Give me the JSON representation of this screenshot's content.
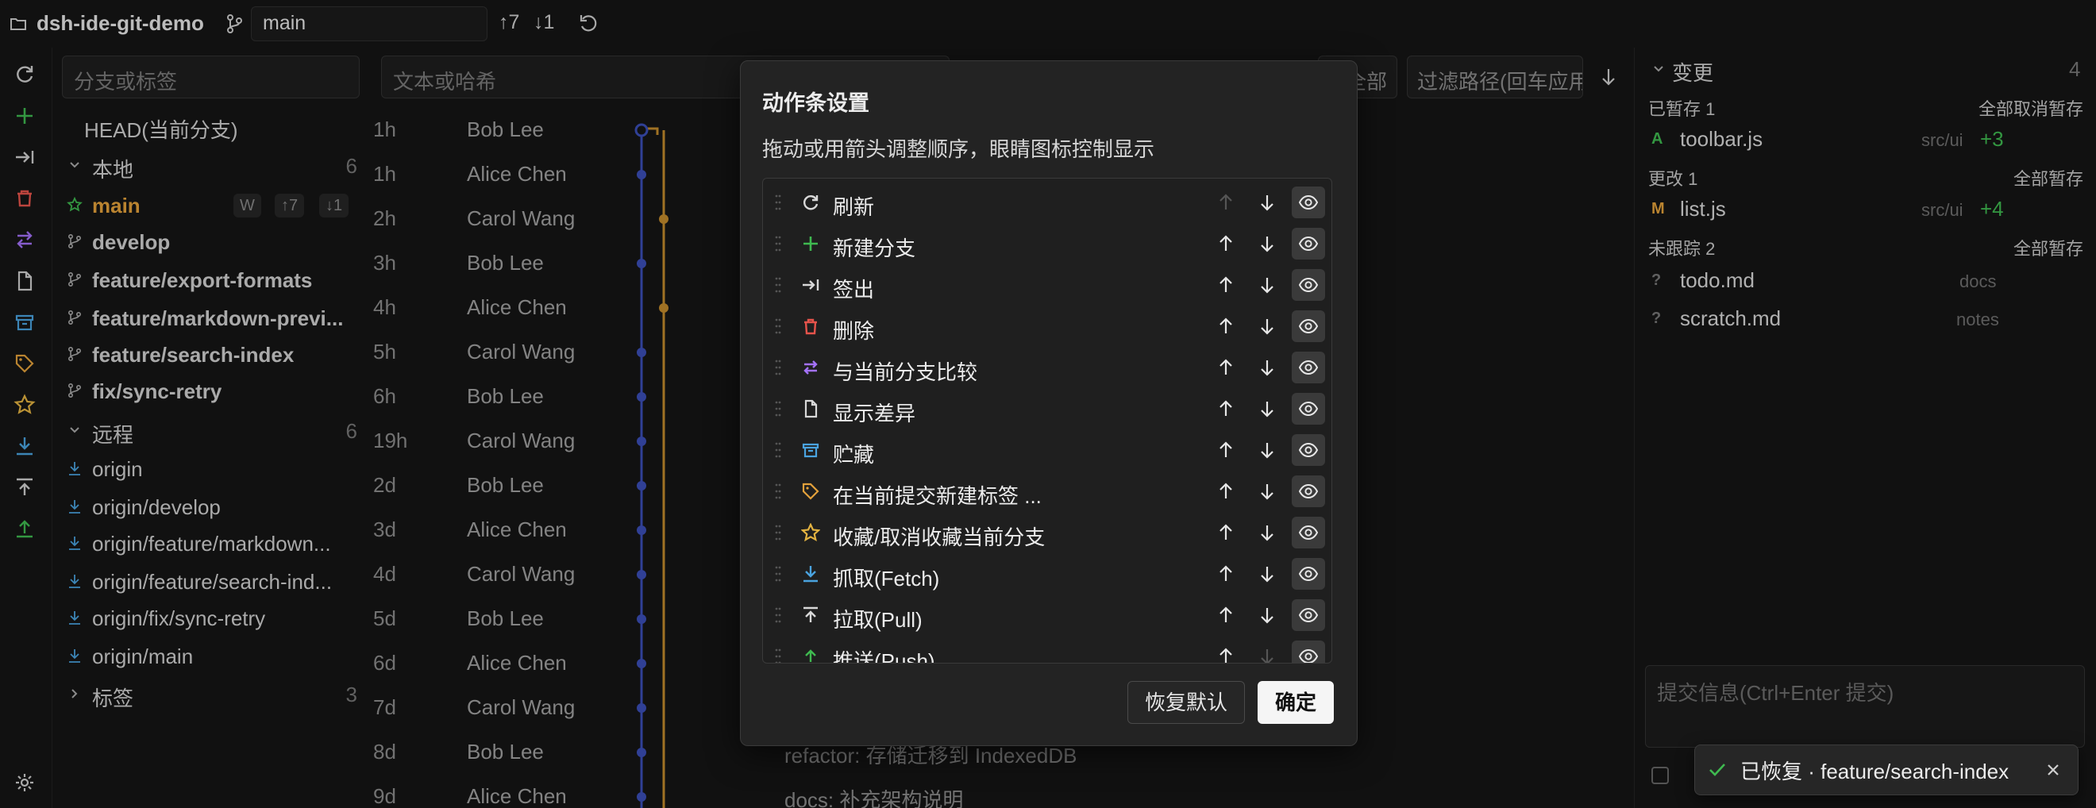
{
  "topbar": {
    "repo_name": "dsh-ide-git-demo",
    "branch_value": "main",
    "ahead": "↑7",
    "behind": "↓1"
  },
  "sidebar": {
    "search_placeholder": "分支或标签",
    "head_label": "HEAD(当前分支)",
    "local": {
      "label": "本地",
      "count": "6"
    },
    "local_branches": [
      {
        "name": "main",
        "badge_w": "W",
        "ahead": "↑7",
        "behind": "↓1"
      },
      {
        "name": "develop"
      },
      {
        "name": "feature/export-formats"
      },
      {
        "name": "feature/markdown-previ..."
      },
      {
        "name": "feature/search-index"
      },
      {
        "name": "fix/sync-retry"
      }
    ],
    "remote": {
      "label": "远程",
      "count": "6"
    },
    "remote_branches": [
      "origin",
      "origin/develop",
      "origin/feature/markdown...",
      "origin/feature/search-ind...",
      "origin/fix/sync-retry",
      "origin/main"
    ],
    "tags": {
      "label": "标签",
      "count": "3"
    }
  },
  "commits": {
    "filter_placeholder": "文本或哈希",
    "scope_label": "全部",
    "path_placeholder": "过滤路径(回车应用)",
    "rows": [
      {
        "time": "1h",
        "author": "Bob Lee"
      },
      {
        "time": "1h",
        "author": "Alice Chen"
      },
      {
        "time": "2h",
        "author": "Carol Wang"
      },
      {
        "time": "3h",
        "author": "Bob Lee"
      },
      {
        "time": "4h",
        "author": "Alice Chen"
      },
      {
        "time": "5h",
        "author": "Carol Wang"
      },
      {
        "time": "6h",
        "author": "Bob Lee"
      },
      {
        "time": "19h",
        "author": "Carol Wang"
      },
      {
        "time": "2d",
        "author": "Bob Lee"
      },
      {
        "time": "3d",
        "author": "Alice Chen"
      },
      {
        "time": "4d",
        "author": "Carol Wang"
      },
      {
        "time": "5d",
        "author": "Bob Lee"
      },
      {
        "time": "6d",
        "author": "Alice Chen"
      },
      {
        "time": "7d",
        "author": "Carol Wang"
      },
      {
        "time": "8d",
        "author": "Bob Lee",
        "message": "refactor: 存储迁移到 IndexedDB"
      },
      {
        "time": "9d",
        "author": "Alice Chen",
        "message": "docs: 补充架构说明"
      }
    ]
  },
  "changes": {
    "title": "变更",
    "count": "4",
    "staged_label": "已暂存 1",
    "unstage_all": "全部取消暂存",
    "staged_files": [
      {
        "status": "A",
        "name": "toolbar.js",
        "path": "src/ui",
        "delta": "+3"
      }
    ],
    "modified_label": "更改 1",
    "stage_all": "全部暂存",
    "modified_files": [
      {
        "status": "M",
        "name": "list.js",
        "path": "src/ui",
        "delta": "+4"
      }
    ],
    "untracked_label": "未跟踪 2",
    "stage_all_untracked": "全部暂存",
    "untracked_files": [
      {
        "status": "?",
        "name": "todo.md",
        "path": "docs"
      },
      {
        "status": "?",
        "name": "scratch.md",
        "path": "notes"
      }
    ],
    "commit_placeholder": "提交信息(Ctrl+Enter 提交)"
  },
  "modal": {
    "title": "动作条设置",
    "description": "拖动或用箭头调整顺序，眼睛图标控制显示",
    "items": [
      {
        "label": "刷新",
        "icon": "refresh-icon",
        "color": "#d8d8d8"
      },
      {
        "label": "新建分支",
        "icon": "plus-icon",
        "color": "#3fb950"
      },
      {
        "label": "签出",
        "icon": "checkout-icon",
        "color": "#d8d8d8"
      },
      {
        "label": "删除",
        "icon": "trash-icon",
        "color": "#e5534b"
      },
      {
        "label": "与当前分支比较",
        "icon": "compare-icon",
        "color": "#a371f7"
      },
      {
        "label": "显示差异",
        "icon": "file-icon",
        "color": "#d8d8d8"
      },
      {
        "label": "贮藏",
        "icon": "archive-icon",
        "color": "#4aa3df"
      },
      {
        "label": "在当前提交新建标签 ...",
        "icon": "tag-icon",
        "color": "#e3a13b"
      },
      {
        "label": "收藏/取消收藏当前分支",
        "icon": "star-icon",
        "color": "#e3b341"
      },
      {
        "label": "抓取(Fetch)",
        "icon": "fetch-icon",
        "color": "#4aa3df"
      },
      {
        "label": "拉取(Pull)",
        "icon": "pull-icon",
        "color": "#d8d8d8"
      },
      {
        "label": "推送(Push)",
        "icon": "push-icon",
        "color": "#3fb950"
      }
    ],
    "reset_label": "恢复默认",
    "ok_label": "确定"
  },
  "toast": {
    "message": "已恢复 · feature/search-index"
  }
}
